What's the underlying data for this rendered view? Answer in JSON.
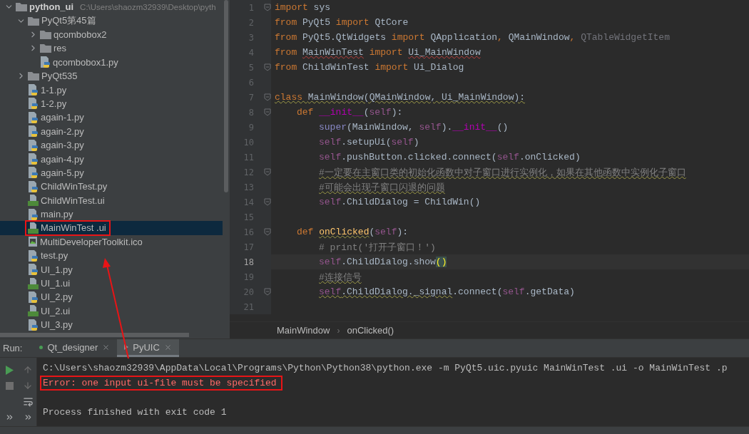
{
  "project_tree": [
    {
      "label": "python_ui",
      "path": "C:\\Users\\shaozm32939\\Desktop\\pyth",
      "kind": "folder",
      "expanded": true,
      "selected": false,
      "boxed": false,
      "children": [
        {
          "label": "PyQt5第45篇",
          "kind": "folder",
          "expanded": true,
          "selected": false,
          "boxed": false,
          "children": [
            {
              "label": "qcombobox2",
              "kind": "folder",
              "expanded": false,
              "selected": false,
              "boxed": false
            },
            {
              "label": "res",
              "kind": "folder",
              "expanded": false,
              "selected": false,
              "boxed": false
            },
            {
              "label": "qcombobox1.py",
              "kind": "python",
              "selected": false,
              "boxed": false
            }
          ]
        },
        {
          "label": "PyQt535",
          "kind": "folder",
          "expanded": false,
          "selected": false,
          "boxed": false
        },
        {
          "label": "1-1.py",
          "kind": "python",
          "selected": false,
          "boxed": false
        },
        {
          "label": "1-2.py",
          "kind": "python",
          "selected": false,
          "boxed": false
        },
        {
          "label": "again-1.py",
          "kind": "python",
          "selected": false,
          "boxed": false
        },
        {
          "label": "again-2.py",
          "kind": "python",
          "selected": false,
          "boxed": false
        },
        {
          "label": "again-3.py",
          "kind": "python",
          "selected": false,
          "boxed": false
        },
        {
          "label": "again-4.py",
          "kind": "python",
          "selected": false,
          "boxed": false
        },
        {
          "label": "again-5.py",
          "kind": "python",
          "selected": false,
          "boxed": false
        },
        {
          "label": "ChildWinTest.py",
          "kind": "python",
          "selected": false,
          "boxed": false
        },
        {
          "label": "ChildWinTest.ui",
          "kind": "qt",
          "selected": false,
          "boxed": false
        },
        {
          "label": "main.py",
          "kind": "python",
          "selected": false,
          "boxed": false
        },
        {
          "label": "MainWinTest .ui",
          "kind": "qt",
          "selected": true,
          "boxed": true
        },
        {
          "label": "MultiDeveloperToolkit.ico",
          "kind": "image",
          "selected": false,
          "boxed": false
        },
        {
          "label": "test.py",
          "kind": "python",
          "selected": false,
          "boxed": false
        },
        {
          "label": "UI_1.py",
          "kind": "python",
          "selected": false,
          "boxed": false
        },
        {
          "label": "UI_1.ui",
          "kind": "qt",
          "selected": false,
          "boxed": false
        },
        {
          "label": "UI_2.py",
          "kind": "python",
          "selected": false,
          "boxed": false
        },
        {
          "label": "UI_2.ui",
          "kind": "qt",
          "selected": false,
          "boxed": false
        },
        {
          "label": "UI_3.py",
          "kind": "python",
          "selected": false,
          "boxed": false
        }
      ]
    }
  ],
  "editor": {
    "lines": [
      {
        "number": "1",
        "fold": true,
        "current": false,
        "tokens": [
          {
            "text": "import ",
            "kind": "kw"
          },
          {
            "text": "sys",
            "kind": "plain"
          }
        ]
      },
      {
        "number": "2",
        "fold": false,
        "current": false,
        "tokens": [
          {
            "text": "from ",
            "kind": "kw"
          },
          {
            "text": "PyQt5 ",
            "kind": "plain"
          },
          {
            "text": "import ",
            "kind": "kw"
          },
          {
            "text": "QtCore",
            "kind": "plain"
          }
        ]
      },
      {
        "number": "3",
        "fold": false,
        "current": false,
        "tokens": [
          {
            "text": "from ",
            "kind": "kw"
          },
          {
            "text": "PyQt5.QtWidgets ",
            "kind": "plain"
          },
          {
            "text": "import ",
            "kind": "kw"
          },
          {
            "text": "QApplication",
            "kind": "plain"
          },
          {
            "text": ", ",
            "kind": "kw"
          },
          {
            "text": "QMainWindow",
            "kind": "plain"
          },
          {
            "text": ", ",
            "kind": "kw"
          },
          {
            "text": "QTableWidgetItem",
            "kind": "unused"
          }
        ]
      },
      {
        "number": "4",
        "fold": false,
        "current": false,
        "tokens": [
          {
            "text": "from ",
            "kind": "kw"
          },
          {
            "text": "MainWinTest",
            "kind": "plain",
            "error": true
          },
          {
            "text": " import ",
            "kind": "kw"
          },
          {
            "text": "Ui_MainWindow",
            "kind": "plain",
            "error": true
          }
        ]
      },
      {
        "number": "5",
        "fold": true,
        "current": false,
        "tokens": [
          {
            "text": "from ",
            "kind": "kw"
          },
          {
            "text": "ChildWinTest ",
            "kind": "plain"
          },
          {
            "text": "import ",
            "kind": "kw"
          },
          {
            "text": "Ui_Dialog",
            "kind": "plain"
          }
        ]
      },
      {
        "number": "6",
        "fold": false,
        "current": false
      },
      {
        "number": "7",
        "fold": true,
        "current": false,
        "tokens": [
          {
            "text": "class ",
            "kind": "kw",
            "warning": true
          },
          {
            "text": "MainWindow(QMainWindow, Ui_MainWindow):",
            "kind": "plain",
            "warning": true
          }
        ],
        "children": [
          {
            "number": "8",
            "fold": true,
            "current": false,
            "tokens": [
              {
                "text": "def ",
                "kind": "kw"
              },
              {
                "text": "__init__",
                "kind": "magic"
              },
              {
                "text": "(",
                "kind": "plain"
              },
              {
                "text": "self",
                "kind": "self"
              },
              {
                "text": "):",
                "kind": "plain"
              }
            ],
            "children": [
              {
                "number": "9",
                "fold": false,
                "current": false,
                "tokens": [
                  {
                    "text": "super",
                    "kind": "builtin"
                  },
                  {
                    "text": "(MainWindow, ",
                    "kind": "plain"
                  },
                  {
                    "text": "self",
                    "kind": "self"
                  },
                  {
                    "text": ").",
                    "kind": "plain"
                  },
                  {
                    "text": "__init__",
                    "kind": "magic"
                  },
                  {
                    "text": "()",
                    "kind": "plain"
                  }
                ]
              },
              {
                "number": "10",
                "fold": false,
                "current": false,
                "tokens": [
                  {
                    "text": "self",
                    "kind": "self"
                  },
                  {
                    "text": ".setupUi(",
                    "kind": "plain"
                  },
                  {
                    "text": "self",
                    "kind": "self"
                  },
                  {
                    "text": ")",
                    "kind": "plain"
                  }
                ]
              },
              {
                "number": "11",
                "fold": false,
                "current": false,
                "tokens": [
                  {
                    "text": "self",
                    "kind": "self"
                  },
                  {
                    "text": ".pushButton.clicked.connect(",
                    "kind": "plain"
                  },
                  {
                    "text": "self",
                    "kind": "self"
                  },
                  {
                    "text": ".onClicked)",
                    "kind": "plain"
                  }
                ]
              },
              {
                "number": "12",
                "fold": true,
                "current": false,
                "tokens": [
                  {
                    "text": "#一定要在主窗口类的初始化函数中对子窗口进行实例化，如果在其他函数中实例化子窗口",
                    "kind": "comment",
                    "warning": true
                  }
                ]
              },
              {
                "number": "13",
                "fold": false,
                "current": false,
                "tokens": [
                  {
                    "text": "#可能会出现子窗口闪退的问题",
                    "kind": "comment",
                    "warning": true
                  }
                ]
              },
              {
                "number": "14",
                "fold": true,
                "current": false,
                "tokens": [
                  {
                    "text": "self",
                    "kind": "self"
                  },
                  {
                    "text": ".ChildDialog = ChildWin()",
                    "kind": "plain"
                  }
                ]
              }
            ]
          },
          {
            "number": "15",
            "fold": false,
            "current": false
          },
          {
            "number": "16",
            "fold": true,
            "current": false,
            "tokens": [
              {
                "text": "def ",
                "kind": "kw"
              },
              {
                "text": "onClicked",
                "kind": "fn",
                "warning": true
              },
              {
                "text": "(",
                "kind": "plain"
              },
              {
                "text": "self",
                "kind": "self"
              },
              {
                "text": "):",
                "kind": "plain"
              }
            ],
            "children": [
              {
                "number": "17",
                "fold": false,
                "current": false,
                "tokens": [
                  {
                    "text": "# print('打开子窗口！')",
                    "kind": "comment"
                  }
                ]
              },
              {
                "number": "18",
                "fold": false,
                "current": true,
                "tokens": [
                  {
                    "text": "self",
                    "kind": "self"
                  },
                  {
                    "text": ".ChildDialog.show",
                    "kind": "plain"
                  },
                  {
                    "text": "()",
                    "kind": "match"
                  }
                ]
              },
              {
                "number": "19",
                "fold": false,
                "current": false,
                "tokens": [
                  {
                    "text": "#连接信号",
                    "kind": "comment",
                    "warning": true
                  }
                ]
              },
              {
                "number": "20",
                "fold": true,
                "current": false,
                "tokens": [
                  {
                    "text": "self",
                    "kind": "self",
                    "warning": true
                  },
                  {
                    "text": ".ChildDialog._signal",
                    "kind": "plain",
                    "warning": true
                  },
                  {
                    "text": ".connect(",
                    "kind": "plain"
                  },
                  {
                    "text": "self",
                    "kind": "self"
                  },
                  {
                    "text": ".getData)",
                    "kind": "plain"
                  }
                ]
              }
            ]
          }
        ]
      },
      {
        "number": "21",
        "fold": false,
        "current": false
      }
    ],
    "breadcrumb": {
      "items": [
        "MainWindow",
        "onClicked()"
      ],
      "separator": "›"
    }
  },
  "run_panel": {
    "label": "Run:",
    "tabs": [
      {
        "label": "Qt_designer",
        "selected": false
      },
      {
        "label": "PyUIC",
        "selected": true
      }
    ],
    "console": [
      {
        "kind": "command",
        "text": "C:\\Users\\shaozm32939\\AppData\\Local\\Programs\\Python\\Python38\\python.exe -m PyQt5.uic.pyuic MainWinTest .ui -o MainWinTest .p",
        "boxed": false
      },
      {
        "kind": "error",
        "text": "Error: one input ui-file must be specified",
        "boxed": true
      },
      {
        "kind": "status",
        "text": "Process finished with exit code 1",
        "boxed": false
      }
    ]
  }
}
